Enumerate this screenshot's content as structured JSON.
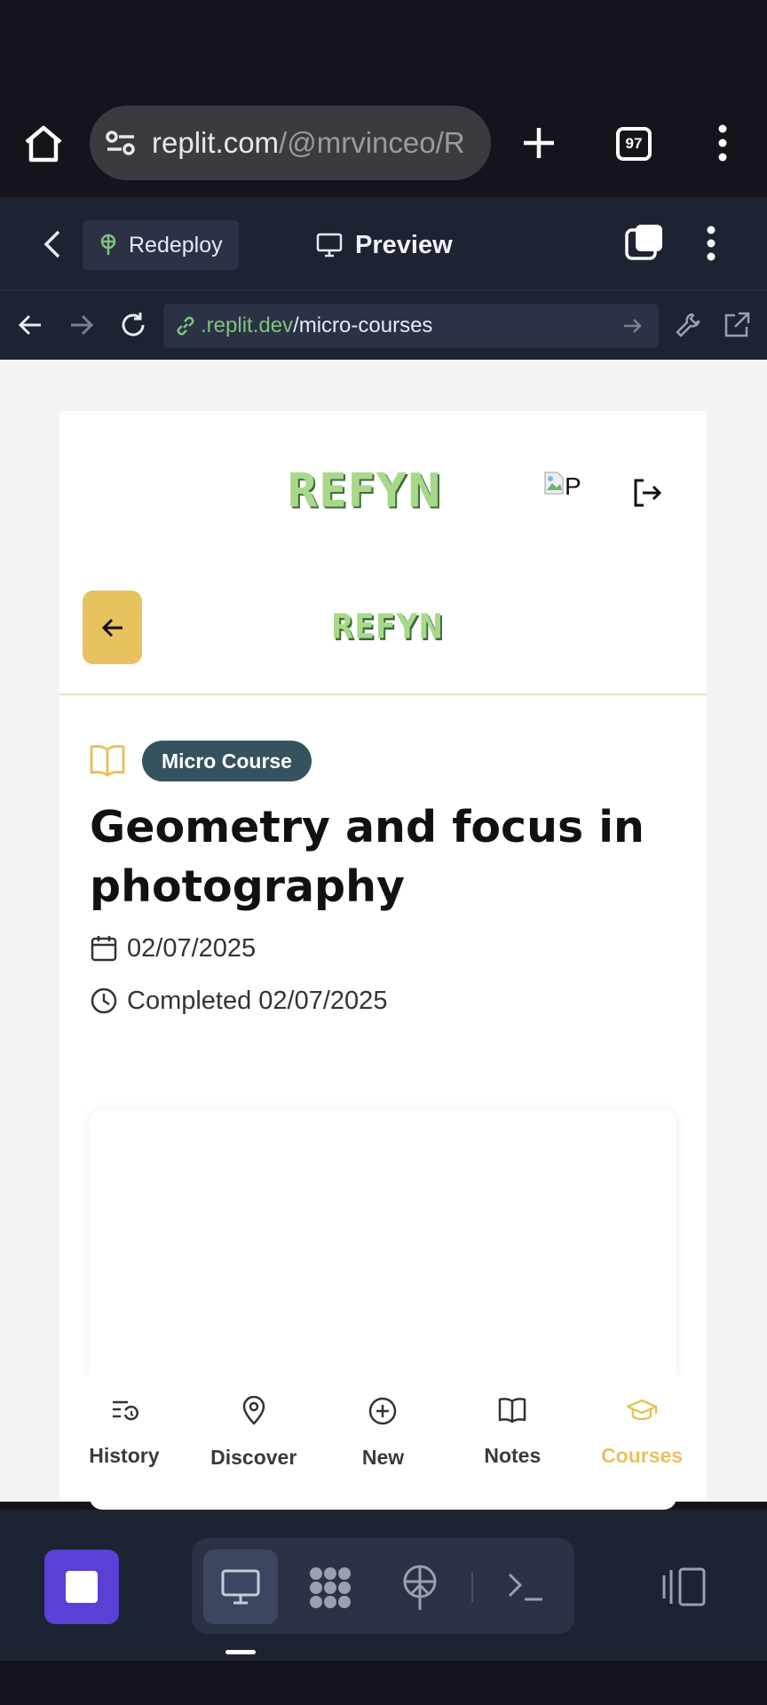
{
  "browser": {
    "url_host": "replit.com",
    "url_path": "/@mrvinceo/R",
    "tab_count": "97"
  },
  "replit_header": {
    "redeploy_label": "Redeploy",
    "preview_label": "Preview"
  },
  "webview": {
    "address_domain": ".replit.dev",
    "address_path": "/micro-courses"
  },
  "app": {
    "logo_text": "REFYN",
    "broken_image_alt": "P",
    "badge": "Micro Course",
    "course_title": "Geometry and focus in photography",
    "date": "02/07/2025",
    "completed": "Completed 02/07/2025"
  },
  "bottom_nav": {
    "items": [
      {
        "label": "History",
        "icon": "history-icon",
        "active": false
      },
      {
        "label": "Discover",
        "icon": "map-pin-icon",
        "active": false
      },
      {
        "label": "New",
        "icon": "plus-circle-icon",
        "active": false
      },
      {
        "label": "Notes",
        "icon": "book-open-icon",
        "active": false
      },
      {
        "label": "Courses",
        "icon": "graduation-cap-icon",
        "active": true
      }
    ]
  },
  "colors": {
    "accent": "#e8c25e",
    "badge_bg": "#35535e",
    "logo_green": "#a8d88a",
    "replit_stop": "#5b3fd6"
  }
}
